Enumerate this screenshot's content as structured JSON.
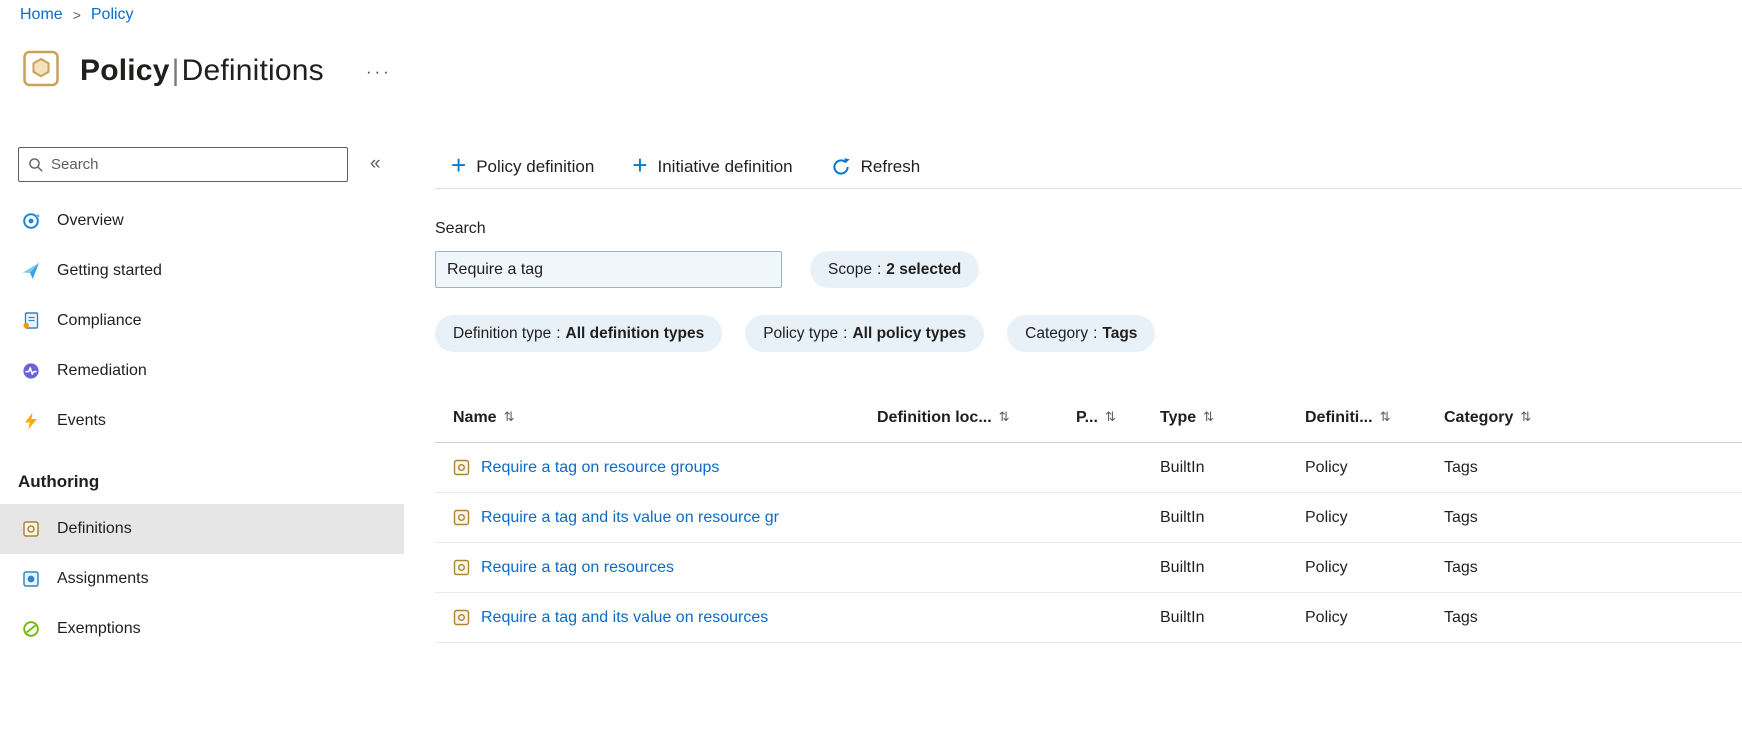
{
  "colors": {
    "accent": "#0078d4",
    "pill_bg": "#e9f1f8",
    "selected_bg": "#e6e6e6",
    "link": "#0b6bc6"
  },
  "breadcrumb": {
    "items": [
      "Home",
      "Policy"
    ],
    "separator": ">"
  },
  "header": {
    "title": "Policy",
    "pipe": "|",
    "subtitle": "Definitions",
    "more": "···"
  },
  "sidebar": {
    "search_placeholder": "Search",
    "collapse_glyph": "«",
    "items": [
      {
        "label": "Overview"
      },
      {
        "label": "Getting started"
      },
      {
        "label": "Compliance"
      },
      {
        "label": "Remediation"
      },
      {
        "label": "Events"
      }
    ],
    "section_title": "Authoring",
    "authoring_items": [
      {
        "label": "Definitions",
        "selected": true
      },
      {
        "label": "Assignments",
        "selected": false
      },
      {
        "label": "Exemptions",
        "selected": false
      }
    ]
  },
  "toolbar": {
    "plus_glyph": "+",
    "items": [
      {
        "label": "Policy definition"
      },
      {
        "label": "Initiative definition"
      },
      {
        "label": "Refresh"
      }
    ]
  },
  "filters": {
    "search_label": "Search",
    "search_value": "Require a tag",
    "pill_sep": ":",
    "pills": [
      {
        "name": "Scope",
        "value": "2 selected"
      },
      {
        "name": "Definition type",
        "value": "All definition types"
      },
      {
        "name": "Policy type",
        "value": "All policy types"
      },
      {
        "name": "Category",
        "value": "Tags"
      }
    ]
  },
  "table": {
    "sort_glyph": "⇅",
    "columns": [
      {
        "label": "Name"
      },
      {
        "label": "Definition loc..."
      },
      {
        "label": "P..."
      },
      {
        "label": "Type"
      },
      {
        "label": "Definiti..."
      },
      {
        "label": "Category"
      }
    ],
    "rows": [
      {
        "name": "Require a tag on resource groups",
        "definition_location": "",
        "policies": "",
        "type": "BuiltIn",
        "definition_type": "Policy",
        "category": "Tags"
      },
      {
        "name": "Require a tag and its value on resource gr",
        "definition_location": "",
        "policies": "",
        "type": "BuiltIn",
        "definition_type": "Policy",
        "category": "Tags"
      },
      {
        "name": "Require a tag on resources",
        "definition_location": "",
        "policies": "",
        "type": "BuiltIn",
        "definition_type": "Policy",
        "category": "Tags"
      },
      {
        "name": "Require a tag and its value on resources",
        "definition_location": "",
        "policies": "",
        "type": "BuiltIn",
        "definition_type": "Policy",
        "category": "Tags"
      }
    ]
  }
}
